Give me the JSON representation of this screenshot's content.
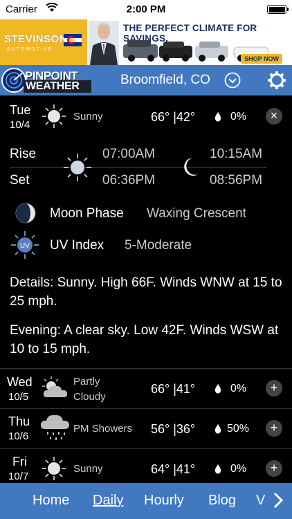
{
  "status_bar": {
    "carrier": "Carrier",
    "time": "2:00 PM"
  },
  "ad": {
    "brand": "STEVINSON",
    "brand_sub": "AUTOMOTIVE",
    "headline": "THE PERFECT CLIMATE FOR SAVINGS.",
    "cta": "SHOP NOW"
  },
  "header": {
    "logo_top": "PINPOINT",
    "logo_bottom": "WEATHER",
    "location": "Broomfield, CO"
  },
  "today": {
    "day": "Tue",
    "date": "10/4",
    "condition": "Sunny",
    "temps": "66° |42°",
    "precip": "0%",
    "rise_label": "Rise",
    "set_label": "Set",
    "sunrise": "07:00AM",
    "sunset": "06:36PM",
    "moonrise": "10:15AM",
    "moonset": "08:56PM",
    "moon_phase_label": "Moon Phase",
    "moon_phase_value": "Waxing Crescent",
    "uv_label": "UV Index",
    "uv_value": "5-Moderate",
    "uv_icon_text": "UV",
    "details": "Details: Sunny. High 66F. Winds WNW at 15 to 25 mph.",
    "evening": "Evening: A clear sky. Low 42F. Winds WSW at 10 to 15 mph.",
    "close_symbol": "×"
  },
  "forecast": [
    {
      "day": "Wed",
      "date": "10/5",
      "condition_line1": "Partly",
      "condition_line2": "Cloudy",
      "temps": "66° |41°",
      "precip": "0%",
      "icon": "partly-cloudy-icon"
    },
    {
      "day": "Thu",
      "date": "10/6",
      "condition_line1": "PM Showers",
      "condition_line2": "",
      "temps": "56° |36°",
      "precip": "50%",
      "icon": "showers-icon"
    },
    {
      "day": "Fri",
      "date": "10/7",
      "condition_line1": "Sunny",
      "condition_line2": "",
      "temps": "64° |41°",
      "precip": "0%",
      "icon": "sun-icon"
    }
  ],
  "expand_symbol": "+",
  "nav": {
    "tabs": [
      "Home",
      "Daily",
      "Hourly",
      "Blog",
      "V"
    ],
    "active": "Daily"
  },
  "colors": {
    "header_blue": "#4178c0",
    "ad_yellow": "#f1b825",
    "background": "#000000"
  }
}
